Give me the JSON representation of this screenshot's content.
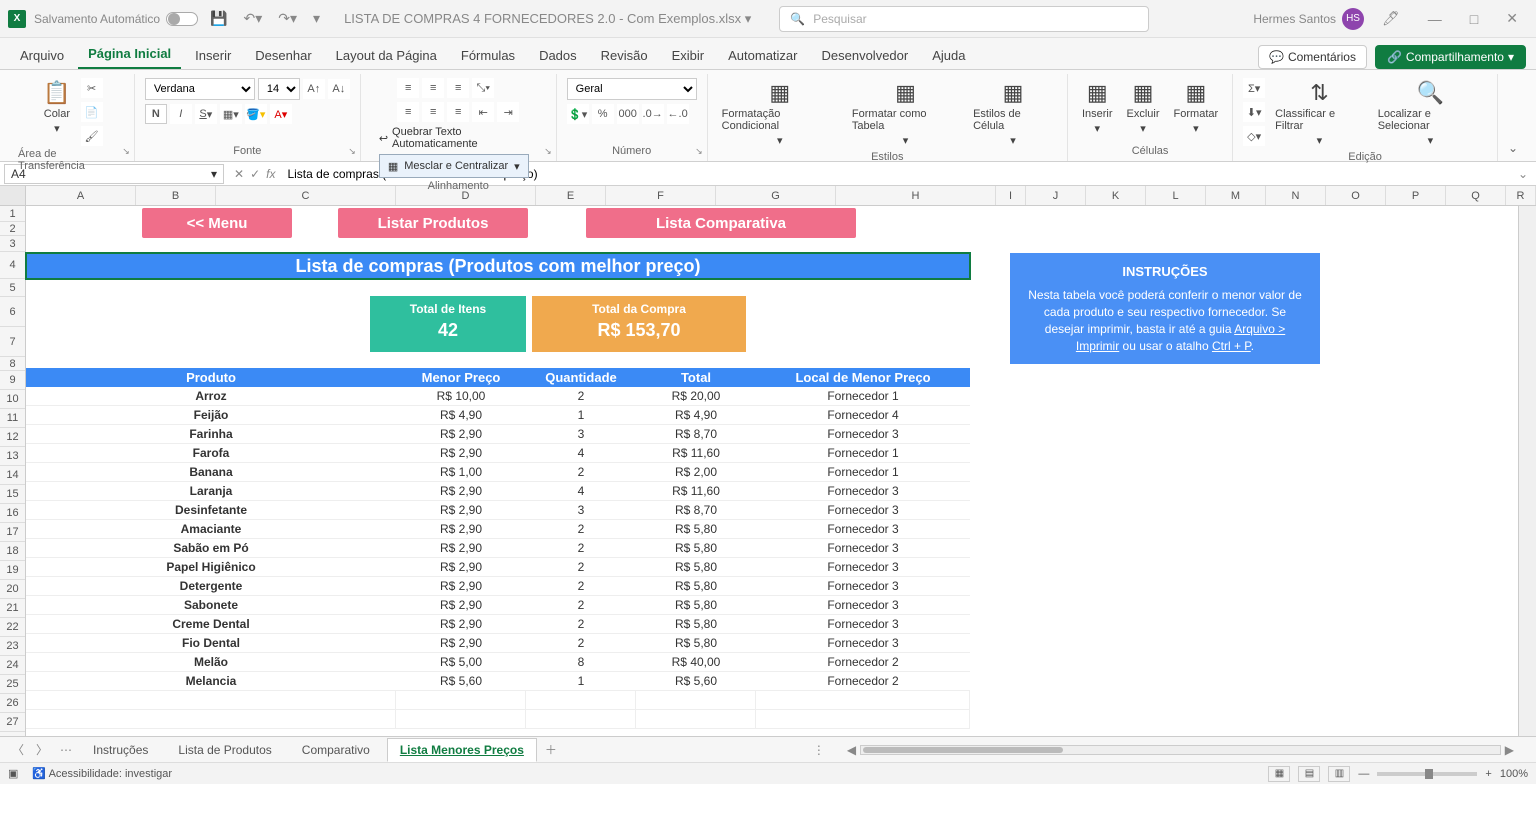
{
  "title": {
    "autosave": "Salvamento Automático",
    "filename": "LISTA DE COMPRAS 4 FORNECEDORES 2.0 - Com Exemplos.xlsx",
    "search_placeholder": "Pesquisar",
    "username": "Hermes Santos",
    "initials": "HS"
  },
  "tabs": {
    "items": [
      "Arquivo",
      "Página Inicial",
      "Inserir",
      "Desenhar",
      "Layout da Página",
      "Fórmulas",
      "Dados",
      "Revisão",
      "Exibir",
      "Automatizar",
      "Desenvolvedor",
      "Ajuda"
    ],
    "active_index": 1,
    "comments": "Comentários",
    "share": "Compartilhamento"
  },
  "ribbon": {
    "paste": "Colar",
    "clipboard": "Área de Transferência",
    "font_group": "Fonte",
    "font_name": "Verdana",
    "font_size": "14",
    "alignment": "Alinhamento",
    "wrap": "Quebrar Texto Automaticamente",
    "merge": "Mesclar e Centralizar",
    "number": "Número",
    "number_format": "Geral",
    "cond_fmt": "Formatação Condicional",
    "fmt_table": "Formatar como Tabela",
    "cell_styles": "Estilos de Célula",
    "styles": "Estilos",
    "insert": "Inserir",
    "delete": "Excluir",
    "format": "Formatar",
    "cells": "Células",
    "sort": "Classificar e Filtrar",
    "find": "Localizar e Selecionar",
    "editing": "Edição"
  },
  "formula_bar": {
    "cell_ref": "A4",
    "formula": "Lista de compras (Produtos com melhor preço)"
  },
  "columns": [
    "A",
    "B",
    "C",
    "D",
    "E",
    "F",
    "G",
    "H",
    "I",
    "J",
    "K",
    "L",
    "M",
    "N",
    "O",
    "P",
    "Q",
    "R"
  ],
  "rows": [
    "1",
    "2",
    "3",
    "4",
    "5",
    "6",
    "7",
    "8",
    "9",
    "10",
    "11",
    "12",
    "13",
    "14",
    "15",
    "16",
    "17",
    "18",
    "19",
    "20",
    "21",
    "22",
    "23",
    "24",
    "25",
    "26",
    "27"
  ],
  "buttons": {
    "menu": "<< Menu",
    "listar": "Listar Produtos",
    "comparativa": "Lista Comparativa"
  },
  "header_bar": "Lista de compras (Produtos com melhor preço)",
  "summary": {
    "items_label": "Total de Itens",
    "items_value": "42",
    "total_label": "Total da Compra",
    "total_value": "R$ 153,70"
  },
  "table": {
    "headers": [
      "Produto",
      "Menor Preço",
      "Quantidade",
      "Total",
      "Local de Menor Preço"
    ],
    "rows": [
      {
        "p": "Arroz",
        "mp": "R$ 10,00",
        "q": "2",
        "t": "R$ 20,00",
        "l": "Fornecedor 1"
      },
      {
        "p": "Feijão",
        "mp": "R$ 4,90",
        "q": "1",
        "t": "R$ 4,90",
        "l": "Fornecedor 4"
      },
      {
        "p": "Farinha",
        "mp": "R$ 2,90",
        "q": "3",
        "t": "R$ 8,70",
        "l": "Fornecedor 3"
      },
      {
        "p": "Farofa",
        "mp": "R$ 2,90",
        "q": "4",
        "t": "R$ 11,60",
        "l": "Fornecedor 1"
      },
      {
        "p": "Banana",
        "mp": "R$ 1,00",
        "q": "2",
        "t": "R$ 2,00",
        "l": "Fornecedor 1"
      },
      {
        "p": "Laranja",
        "mp": "R$ 2,90",
        "q": "4",
        "t": "R$ 11,60",
        "l": "Fornecedor 3"
      },
      {
        "p": "Desinfetante",
        "mp": "R$ 2,90",
        "q": "3",
        "t": "R$ 8,70",
        "l": "Fornecedor 3"
      },
      {
        "p": "Amaciante",
        "mp": "R$ 2,90",
        "q": "2",
        "t": "R$ 5,80",
        "l": "Fornecedor 3"
      },
      {
        "p": "Sabão em Pó",
        "mp": "R$ 2,90",
        "q": "2",
        "t": "R$ 5,80",
        "l": "Fornecedor 3"
      },
      {
        "p": "Papel Higiênico",
        "mp": "R$ 2,90",
        "q": "2",
        "t": "R$ 5,80",
        "l": "Fornecedor 3"
      },
      {
        "p": "Detergente",
        "mp": "R$ 2,90",
        "q": "2",
        "t": "R$ 5,80",
        "l": "Fornecedor 3"
      },
      {
        "p": "Sabonete",
        "mp": "R$ 2,90",
        "q": "2",
        "t": "R$ 5,80",
        "l": "Fornecedor 3"
      },
      {
        "p": "Creme Dental",
        "mp": "R$ 2,90",
        "q": "2",
        "t": "R$ 5,80",
        "l": "Fornecedor 3"
      },
      {
        "p": "Fio Dental",
        "mp": "R$ 2,90",
        "q": "2",
        "t": "R$ 5,80",
        "l": "Fornecedor 3"
      },
      {
        "p": "Melão",
        "mp": "R$ 5,00",
        "q": "8",
        "t": "R$ 40,00",
        "l": "Fornecedor 2"
      },
      {
        "p": "Melancia",
        "mp": "R$ 5,60",
        "q": "1",
        "t": "R$ 5,60",
        "l": "Fornecedor 2"
      }
    ]
  },
  "instructions": {
    "title": "INSTRUÇÕES",
    "body_1": "Nesta tabela você poderá conferir o menor valor de cada produto e seu respectivo fornecedor. Se desejar imprimir, basta ir até a guia ",
    "link1": "Arquivo > Imprimir",
    "body_2": " ou usar o atalho ",
    "link2": "Ctrl + P",
    "body_3": "."
  },
  "sheets": {
    "tabs": [
      "Instruções",
      "Lista de Produtos",
      "Comparativo",
      "Lista Menores Preços"
    ],
    "active_index": 3
  },
  "status": {
    "ready": "",
    "accessibility": "Acessibilidade: investigar",
    "zoom": "100%"
  }
}
